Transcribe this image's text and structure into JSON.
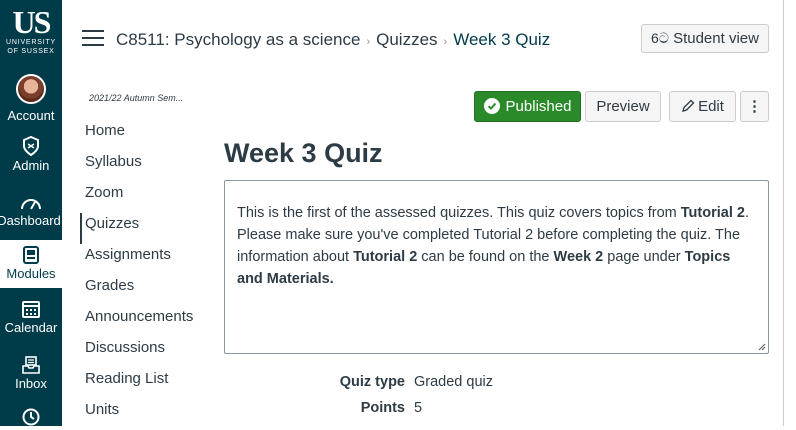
{
  "rail": {
    "logo_main": "US",
    "logo_line1": "UNIVERSITY",
    "logo_line2": "OF SUSSEX",
    "items": [
      {
        "label": "Account",
        "icon": "avatar"
      },
      {
        "label": "Admin",
        "icon": "shield-icon"
      },
      {
        "label": "Dashboard",
        "icon": "dashboard-icon"
      },
      {
        "label": "Modules",
        "icon": "modules-icon"
      },
      {
        "label": "Calendar",
        "icon": "calendar-icon"
      },
      {
        "label": "Inbox",
        "icon": "inbox-icon"
      }
    ]
  },
  "header": {
    "course": "C8511: Psychology as a science",
    "section": "Quizzes",
    "page": "Week 3 Quiz",
    "student_view": "Student view",
    "sep": "›"
  },
  "toolbar": {
    "published": "Published",
    "preview": "Preview",
    "edit": "Edit",
    "more": "⋮"
  },
  "term": "2021/22 Autumn Sem...",
  "course_nav": [
    "Home",
    "Syllabus",
    "Zoom",
    "Quizzes",
    "Assignments",
    "Grades",
    "Announcements",
    "Discussions",
    "Reading List",
    "Units"
  ],
  "quiz": {
    "title": "Week 3 Quiz",
    "desc": {
      "p1": "This is the first of the assessed quizzes.  This quiz covers topics from ",
      "b1": "Tutorial 2",
      "p2": ". Please make sure you've completed Tutorial 2 before completing the quiz. The information about ",
      "b2": "Tutorial 2",
      "p3": " can be found on the ",
      "b3": "Week 2",
      "p4": " page under ",
      "b4": "Topics and Materials."
    },
    "details": [
      {
        "key": "Quiz type",
        "value": "Graded quiz"
      },
      {
        "key": "Points",
        "value": "5"
      }
    ]
  },
  "colors": {
    "rail_bg": "#003b4a",
    "published_green": "#2a8a2a"
  }
}
